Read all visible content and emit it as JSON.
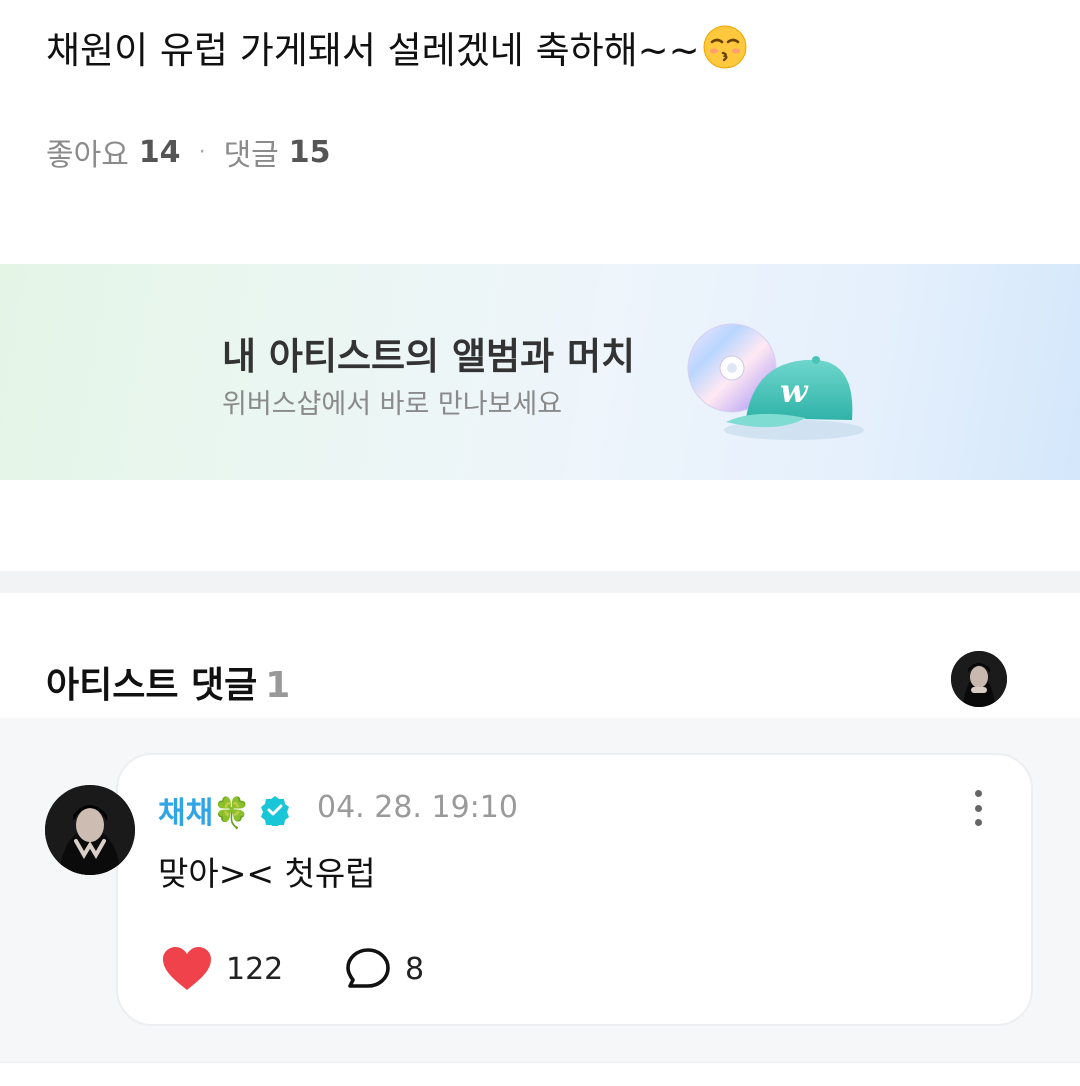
{
  "post": {
    "text": "채원이 유럽 가게돼서 설레겠네 축하해~~",
    "emoji": "kissing-face-with-closed-eyes-emoji"
  },
  "stats": {
    "likes_label": "좋아요",
    "likes_count": "14",
    "separator": "·",
    "comments_label": "댓글",
    "comments_count": "15"
  },
  "banner": {
    "title": "내 아티스트의 앨범과 머치",
    "subtitle": "위버스샵에서 바로 만나보세요",
    "art_icons": [
      "cd-icon",
      "cap-icon"
    ],
    "cap_letter": "w"
  },
  "artist_comments": {
    "title": "아티스트 댓글",
    "count": "1"
  },
  "comment": {
    "author": "채채🍀",
    "verified_icon": "verified-badge-icon",
    "timestamp": "04. 28. 19:10",
    "body": "맞아>< 첫유럽",
    "likes": "122",
    "replies": "8"
  },
  "colors": {
    "author": "#2fa4e7",
    "heart": "#f0424a",
    "verified": "#19c6d8",
    "banner_start": "#e4f5e6",
    "banner_end": "#d4e7fb"
  }
}
